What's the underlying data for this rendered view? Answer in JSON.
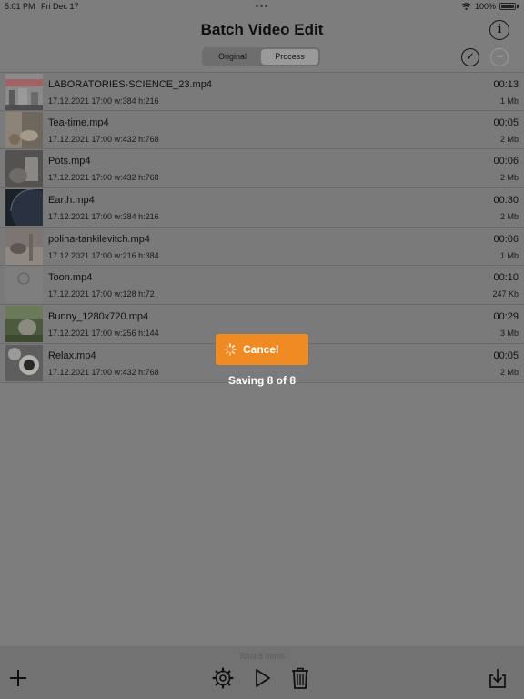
{
  "status_bar": {
    "time": "5:01 PM",
    "date": "Fri Dec 17",
    "battery": "100%"
  },
  "header": {
    "title": "Batch Video Edit"
  },
  "segmented": {
    "options": [
      "Original",
      "Process"
    ],
    "selected": "Process"
  },
  "videos": [
    {
      "name": "LABORATORIES-SCIENCE_23.mp4",
      "meta": "17.12.2021 17:00 w:384 h:216",
      "duration": "00:13",
      "size": "1 Mb"
    },
    {
      "name": "Tea-time.mp4",
      "meta": "17.12.2021 17:00 w:432 h:768",
      "duration": "00:05",
      "size": "2 Mb"
    },
    {
      "name": "Pots.mp4",
      "meta": "17.12.2021 17:00 w:432 h:768",
      "duration": "00:06",
      "size": "2 Mb"
    },
    {
      "name": "Earth.mp4",
      "meta": "17.12.2021 17:00 w:384 h:216",
      "duration": "00:30",
      "size": "2 Mb"
    },
    {
      "name": "polina-tankilevitch.mp4",
      "meta": "17.12.2021 17:00 w:216 h:384",
      "duration": "00:06",
      "size": "1 Mb"
    },
    {
      "name": "Toon.mp4",
      "meta": "17.12.2021 17:00 w:128 h:72",
      "duration": "00:10",
      "size": "247 Kb"
    },
    {
      "name": "Bunny_1280x720.mp4",
      "meta": "17.12.2021 17:00 w:256 h:144",
      "duration": "00:29",
      "size": "3 Mb"
    },
    {
      "name": "Relax.mp4",
      "meta": "17.12.2021 17:00 w:432 h:768",
      "duration": "00:05",
      "size": "2 Mb"
    }
  ],
  "progress": {
    "cancel_label": "Cancel",
    "status": "Saving 8 of 8"
  },
  "footer": {
    "total": "Total 8 Items"
  },
  "colors": {
    "accent": "#f08a23",
    "overlay_bg": "#7d7d7d"
  },
  "icons": [
    "wifi-icon",
    "battery-icon",
    "info-icon",
    "checkmark-circle-icon",
    "ellipsis-circle-icon",
    "plus-icon",
    "gear-icon",
    "play-icon",
    "trash-icon",
    "download-icon",
    "spinner-icon"
  ]
}
